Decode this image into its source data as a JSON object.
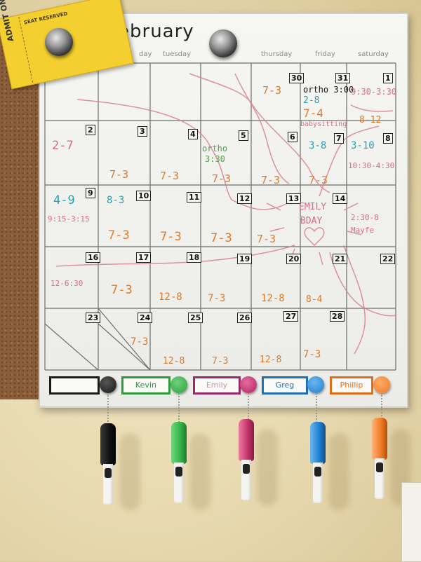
{
  "calendar": {
    "month": "ebruary",
    "daynames": [
      "day",
      "tuesday",
      "thursday",
      "friday",
      "saturday"
    ],
    "dates": [
      {
        "text": "30"
      },
      {
        "text": "31"
      },
      {
        "text": "1"
      },
      {
        "text": "2"
      },
      {
        "text": "3"
      },
      {
        "text": "4"
      },
      {
        "text": "5"
      },
      {
        "text": "6"
      },
      {
        "text": "7"
      },
      {
        "text": "8"
      },
      {
        "text": "9"
      },
      {
        "text": "10"
      },
      {
        "text": "11"
      },
      {
        "text": "12"
      },
      {
        "text": "13"
      },
      {
        "text": "14"
      },
      {
        "text": "16"
      },
      {
        "text": "17"
      },
      {
        "text": "18"
      },
      {
        "text": "19"
      },
      {
        "text": "20"
      },
      {
        "text": "21"
      },
      {
        "text": "22"
      },
      {
        "text": "23"
      },
      {
        "text": "24"
      },
      {
        "text": "25"
      },
      {
        "text": "26"
      },
      {
        "text": "27"
      },
      {
        "text": "28"
      }
    ],
    "notes": [
      {
        "text": "7-3",
        "color": "#e07a28"
      },
      {
        "text": "ortho 3:00",
        "color": "#111111"
      },
      {
        "text": "2-8",
        "color": "#2a9fb0"
      },
      {
        "text": "7-4",
        "color": "#e07a28"
      },
      {
        "text": "9:30-3:30",
        "color": "#d86b8e"
      },
      {
        "text": "babysitting",
        "color": "#d86b8e"
      },
      {
        "text": "8-12",
        "color": "#e07a28"
      },
      {
        "text": "2-7",
        "color": "#d86b8e"
      },
      {
        "text": "ortho",
        "color": "#4aa64a"
      },
      {
        "text": "3:30",
        "color": "#4aa64a"
      },
      {
        "text": "3-8",
        "color": "#2a9fb0"
      },
      {
        "text": "3-10",
        "color": "#2a9fb0"
      },
      {
        "text": "10:30-4:30",
        "color": "#d86b8e"
      },
      {
        "text": "7-3",
        "color": "#e07a28"
      },
      {
        "text": "7-3",
        "color": "#e07a28"
      },
      {
        "text": "7-3",
        "color": "#e07a28"
      },
      {
        "text": "7-3",
        "color": "#e07a28"
      },
      {
        "text": "7-3",
        "color": "#e07a28"
      },
      {
        "text": "4-9",
        "color": "#2a9fb0"
      },
      {
        "text": "9:15-3:15",
        "color": "#d86b8e"
      },
      {
        "text": "8-3",
        "color": "#2a9fb0"
      },
      {
        "text": "7-3",
        "color": "#e07a28"
      },
      {
        "text": "7-3",
        "color": "#e07a28"
      },
      {
        "text": "7-3",
        "color": "#e07a28"
      },
      {
        "text": "7-3",
        "color": "#e07a28"
      },
      {
        "text": "EMILY",
        "color": "#d86b8e"
      },
      {
        "text": "BDAY",
        "color": "#d86b8e"
      },
      {
        "text": "2:30-8",
        "color": "#d86b8e"
      },
      {
        "text": "Mayfe",
        "color": "#d86b8e"
      },
      {
        "text": "12-6:30",
        "color": "#d86b8e"
      },
      {
        "text": "7-3",
        "color": "#e07a28"
      },
      {
        "text": "12-8",
        "color": "#e07a28"
      },
      {
        "text": "7-3",
        "color": "#e07a28"
      },
      {
        "text": "12-8",
        "color": "#e07a28"
      },
      {
        "text": "8-4",
        "color": "#e07a28"
      },
      {
        "text": "7-3",
        "color": "#e07a28"
      },
      {
        "text": "12-8",
        "color": "#e07a28"
      },
      {
        "text": "7-3",
        "color": "#e07a28"
      },
      {
        "text": "12-8",
        "color": "#e07a28"
      },
      {
        "text": "7-3",
        "color": "#e07a28"
      }
    ]
  },
  "ticket": {
    "admit": "ADMIT ONE",
    "seat": "SEAT RESERVED"
  },
  "people": [
    {
      "name": "",
      "color": "#1a1a1a",
      "knob": "#1a1a1a",
      "cap": "#1a1a1a"
    },
    {
      "name": "Kevin",
      "color": "#2e9a3c",
      "knob": "#2ea33e",
      "cap": "#35b24a"
    },
    {
      "name": "Emily",
      "color": "#9a2a6a",
      "knob": "#b02468",
      "cap": "#c2336a"
    },
    {
      "name": "Greg",
      "color": "#1f6fb3",
      "knob": "#1e7fd0",
      "cap": "#1e7fd0"
    },
    {
      "name": "Phillip",
      "color": "#e46d1c",
      "knob": "#ef7a24",
      "cap": "#ef7a24"
    }
  ]
}
